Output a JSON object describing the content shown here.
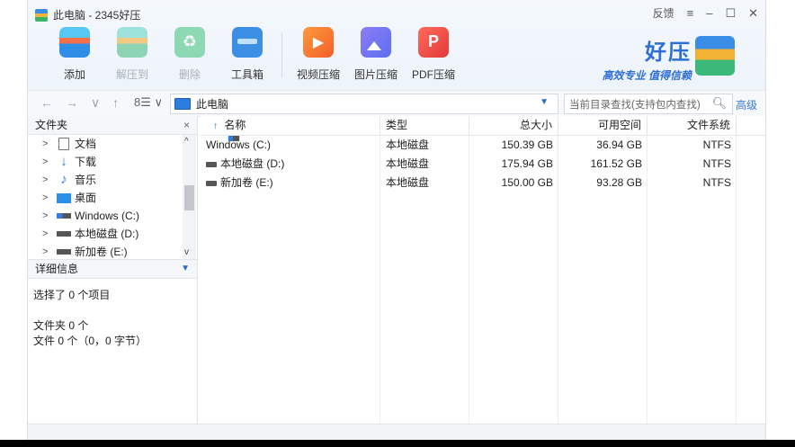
{
  "app": {
    "title": "此电脑 - 2345好压"
  },
  "window_controls": {
    "feedback": "反馈",
    "menu": "≡",
    "minimize": "–",
    "maximize": "☐",
    "close": "✕"
  },
  "toolbar": [
    {
      "label": "添加",
      "icon": "add-archive-icon",
      "enabled": true
    },
    {
      "label": "解压到",
      "icon": "extract-icon",
      "enabled": false
    },
    {
      "label": "删除",
      "icon": "recycle-icon",
      "enabled": false
    },
    {
      "label": "工具箱",
      "icon": "toolbox-icon",
      "enabled": true
    },
    {
      "label": "视频压缩",
      "icon": "video-compress-icon",
      "enabled": true
    },
    {
      "label": "图片压缩",
      "icon": "image-compress-icon",
      "enabled": true
    },
    {
      "label": "PDF压缩",
      "icon": "pdf-compress-icon",
      "enabled": true
    }
  ],
  "brand": {
    "name": "好压",
    "slogan": "高效专业 值得信赖"
  },
  "nav": {
    "back": "←",
    "forward": "→",
    "history": "∨",
    "up": "↑",
    "view": "8☰",
    "view_dd": "∨"
  },
  "address": {
    "value": "此电脑",
    "dropdown": "▼"
  },
  "search": {
    "placeholder": "当前目录查找(支持包内查找)",
    "icon": "search-icon"
  },
  "advanced_label": "高级",
  "folder_panel": {
    "title": "文件夹",
    "close": "×",
    "items": [
      {
        "label": "文档",
        "icon": "document-icon"
      },
      {
        "label": "下载",
        "icon": "download-icon"
      },
      {
        "label": "音乐",
        "icon": "music-icon"
      },
      {
        "label": "桌面",
        "icon": "desktop-icon"
      },
      {
        "label": "Windows (C:)",
        "icon": "windows-drive-icon"
      },
      {
        "label": "本地磁盘 (D:)",
        "icon": "drive-icon"
      },
      {
        "label": "新加卷 (E:)",
        "icon": "drive-icon"
      }
    ]
  },
  "details_panel": {
    "title": "详细信息",
    "selected": "选择了 0 个项目",
    "folders": "文件夹 0 个",
    "files": "文件 0 个（0，0 字节）"
  },
  "columns": {
    "sort_arrow": "↑",
    "name": "名称",
    "type": "类型",
    "total": "总大小",
    "free": "可用空间",
    "fs": "文件系统"
  },
  "drives": [
    {
      "name": "Windows (C:)",
      "type": "本地磁盘",
      "total": "150.39 GB",
      "free": "36.94 GB",
      "fs": "NTFS"
    },
    {
      "name": "本地磁盘 (D:)",
      "type": "本地磁盘",
      "total": "175.94 GB",
      "free": "161.52 GB",
      "fs": "NTFS"
    },
    {
      "name": "新加卷 (E:)",
      "type": "本地磁盘",
      "total": "150.00 GB",
      "free": "93.28 GB",
      "fs": "NTFS"
    }
  ]
}
